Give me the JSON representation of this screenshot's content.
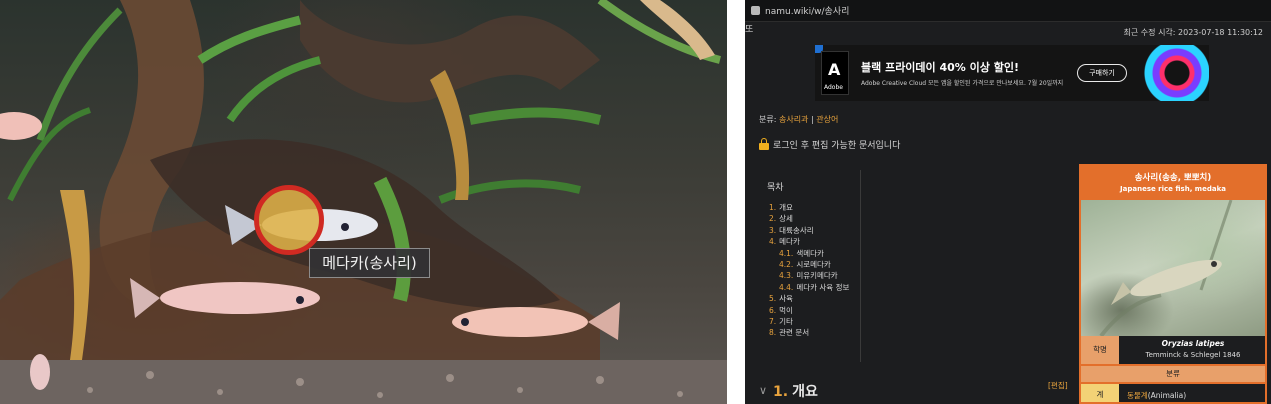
{
  "photo": {
    "label": "메다카(송사리)",
    "hotspot_color": "#d02a22"
  },
  "wiki": {
    "url": "namu.wiki/w/송사리",
    "top_fragment": "또",
    "last_modified": "최근 수정 시각: 2023-07-18 11:30:12",
    "ad": {
      "logo_text": "Adobe",
      "title": "블랙 프라이데이 40% 이상 할인!",
      "subtitle": "Adobe Creative Cloud 모든 앱을 할인된 가격으로 만나보세요. 7월 20일까지",
      "cta": "구매하기"
    },
    "breadcrumb": {
      "prefix": "분류:",
      "link1": "송사리과",
      "separator": "|",
      "link2": "관상어"
    },
    "lock_note": "로그인 후 편집 가능한 문서입니다",
    "toc": {
      "title": "목차",
      "items": [
        {
          "num": "1.",
          "label": "개요"
        },
        {
          "num": "2.",
          "label": "상세"
        },
        {
          "num": "3.",
          "label": "대륙송사리"
        },
        {
          "num": "4.",
          "label": "메다카"
        },
        {
          "num": "4.1.",
          "label": "색메다카"
        },
        {
          "num": "4.2.",
          "label": "시로메다카"
        },
        {
          "num": "4.3.",
          "label": "미유키메다카"
        },
        {
          "num": "4.4.",
          "label": "메다카 사육 정보"
        },
        {
          "num": "5.",
          "label": "사육"
        },
        {
          "num": "6.",
          "label": "먹이"
        },
        {
          "num": "7.",
          "label": "기타"
        },
        {
          "num": "8.",
          "label": "관련 문서"
        }
      ]
    },
    "infobox": {
      "name": "송사리(송송, 뽀뽀치)",
      "name_en": "Japanese rice fish, medaka",
      "sci_label": "학명",
      "sci_name": "Oryzias latipes",
      "author": "Temminck & Schlegel 1846",
      "classification": "분류",
      "kingdom_label": "계",
      "kingdom_link": "동물계",
      "kingdom_rest": "(Animalia)",
      "accent": "#e36f2b"
    },
    "section": {
      "toggle": "∨",
      "num": "1.",
      "title": "개요",
      "edit": "[편집]"
    }
  }
}
